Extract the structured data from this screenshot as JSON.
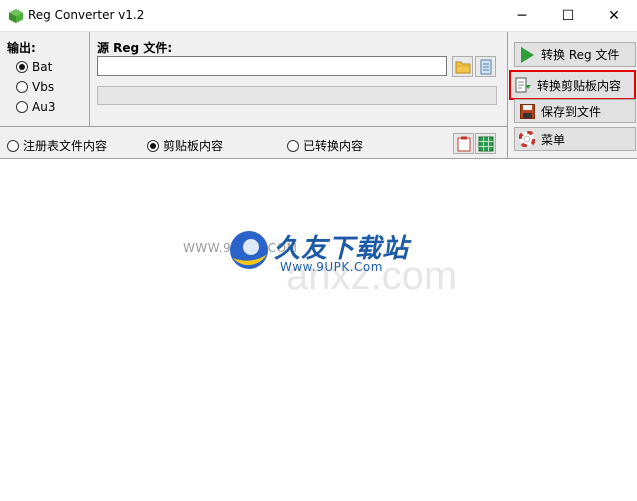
{
  "window": {
    "title": "Reg Converter v1.2",
    "minimize_glyph": "─",
    "maximize_glyph": "☐",
    "close_glyph": "✕"
  },
  "output": {
    "label": "输出:",
    "options": [
      {
        "label": "Bat",
        "selected": true
      },
      {
        "label": "Vbs",
        "selected": false
      },
      {
        "label": "Au3",
        "selected": false
      }
    ]
  },
  "source": {
    "label": "源 Reg 文件:",
    "value": "",
    "progress": 0
  },
  "mode": {
    "options": [
      {
        "label": "注册表文件内容",
        "selected": false
      },
      {
        "label": "剪贴板内容",
        "selected": true
      },
      {
        "label": "已转换内容",
        "selected": false
      }
    ]
  },
  "actions": {
    "convert_reg": "转换 Reg 文件",
    "convert_clipboard": "转换剪贴板内容",
    "save_to_file": "保存到文件",
    "menu": "菜单"
  },
  "watermark": {
    "url_left": "WWW.9U",
    "url_right": "K.COM",
    "brand": "久友下载站",
    "site": "Www.9UPK.Com",
    "ghost": "anxz.com"
  },
  "colors": {
    "highlight": "#e00000",
    "watermark_blue": "#1c5aa6"
  }
}
